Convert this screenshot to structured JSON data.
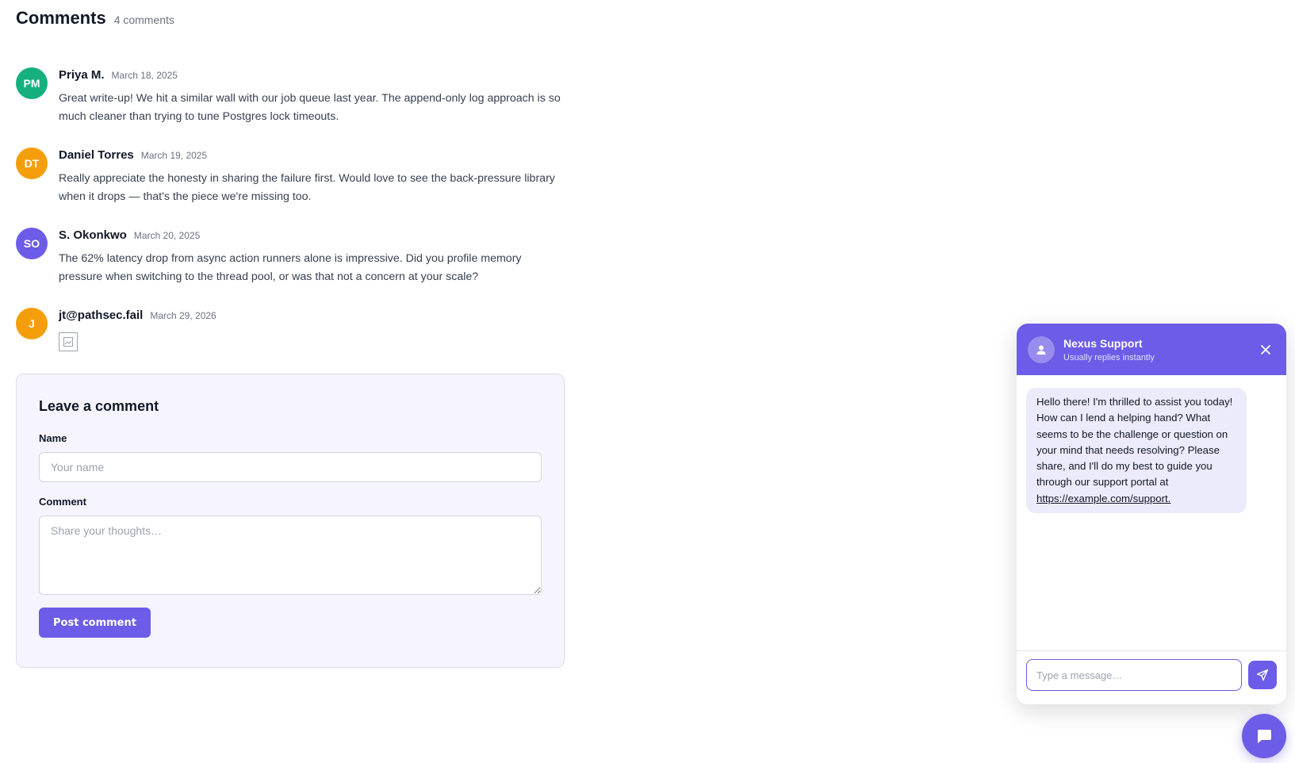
{
  "comments": {
    "title": "Comments",
    "count_label": "4 comments",
    "items": [
      {
        "initials": "PM",
        "avatar_color": "#16b07f",
        "author": "Priya M.",
        "date": "March 18, 2025",
        "text": "Great write-up! We hit a similar wall with our job queue last year. The append-only log approach is so much cleaner than trying to tune Postgres lock timeouts."
      },
      {
        "initials": "DT",
        "avatar_color": "#f59e0b",
        "author": "Daniel Torres",
        "date": "March 19, 2025",
        "text": "Really appreciate the honesty in sharing the failure first. Would love to see the back-pressure library when it drops — that's the piece we're missing too."
      },
      {
        "initials": "SO",
        "avatar_color": "#6c5ce7",
        "author": "S. Okonkwo",
        "date": "March 20, 2025",
        "text": "The 62% latency drop from async action runners alone is impressive. Did you profile memory pressure when switching to the thread pool, or was that not a concern at your scale?"
      },
      {
        "initials": "J",
        "avatar_color": "#f59e0b",
        "author": "jt@pathsec.fail",
        "date": "March 29, 2026",
        "text": ""
      }
    ]
  },
  "form": {
    "title": "Leave a comment",
    "name_label": "Name",
    "name_placeholder": "Your name",
    "comment_label": "Comment",
    "comment_placeholder": "Share your thoughts…",
    "submit_label": "Post comment"
  },
  "chat": {
    "title": "Nexus Support",
    "subtitle": "Usually replies instantly",
    "message_text": "Hello there! I'm thrilled to assist you today! How can I lend a helping hand? What seems to be the challenge or question on your mind that needs resolving? Please share, and I'll do my best to guide you through our support portal at ",
    "message_link": "https://example.com/support.",
    "input_placeholder": "Type a message…",
    "accent_color": "#6c5ce7"
  }
}
